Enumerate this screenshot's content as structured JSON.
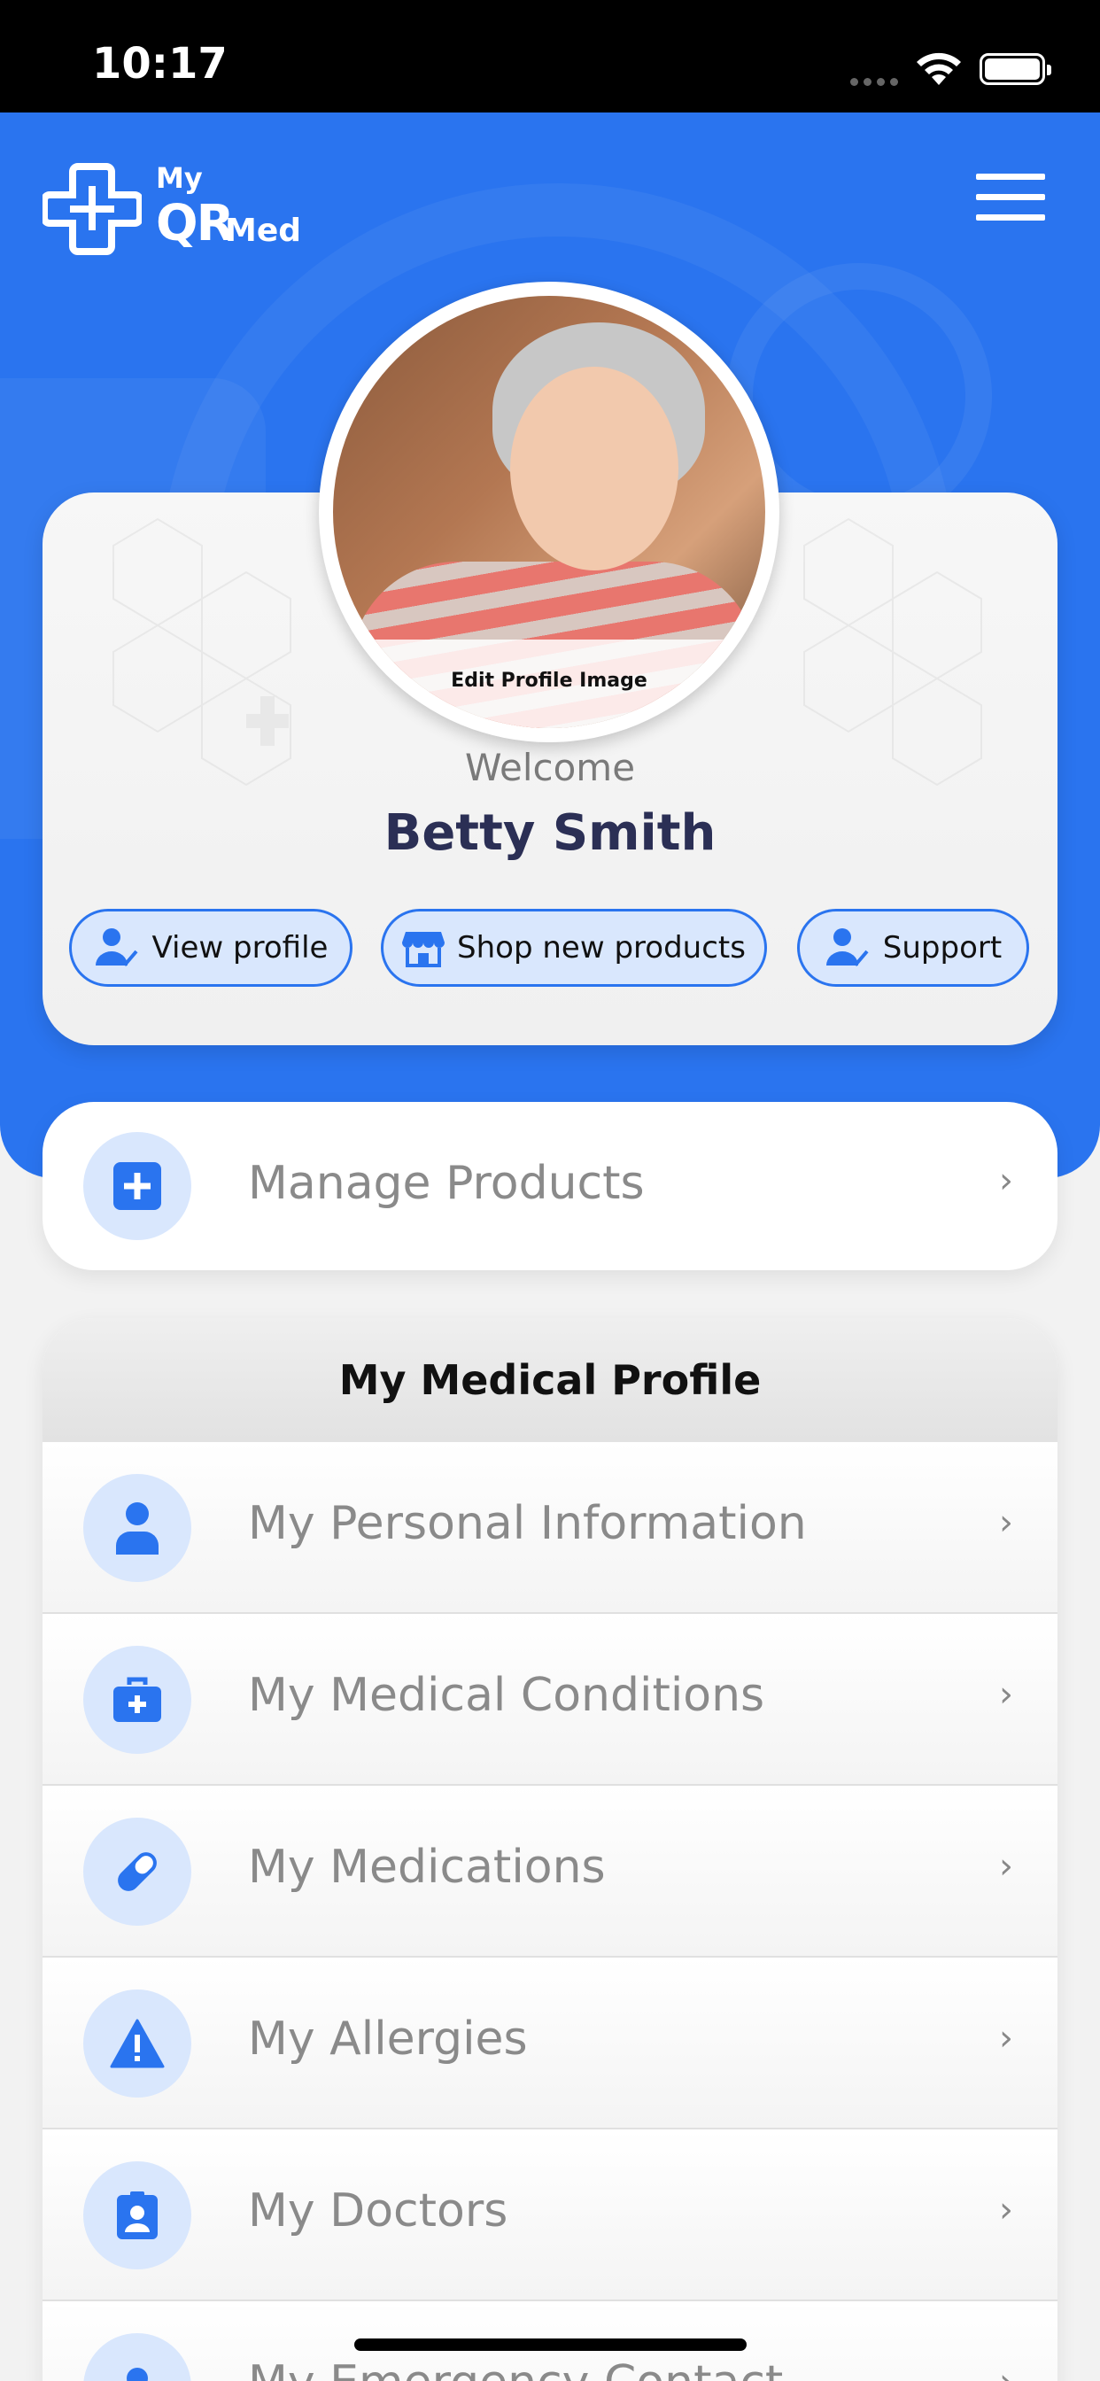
{
  "status_bar": {
    "time": "10:17"
  },
  "app": {
    "logo_my": "My",
    "logo_qr": "QR",
    "logo_med": "Med"
  },
  "profile": {
    "edit_image_label": "Edit Profile Image",
    "welcome": "Welcome",
    "name": "Betty Smith",
    "actions": [
      {
        "label": "View profile",
        "icon": "user-check-icon"
      },
      {
        "label": "Shop new products",
        "icon": "store-icon"
      },
      {
        "label": "Support",
        "icon": "user-check-icon"
      }
    ]
  },
  "manage_products": {
    "label": "Manage Products",
    "icon": "plus-square-icon"
  },
  "medical_profile": {
    "title": "My Medical Profile",
    "items": [
      {
        "label": "My Personal Information",
        "icon": "person-icon"
      },
      {
        "label": "My Medical Conditions",
        "icon": "medkit-icon"
      },
      {
        "label": "My Medications",
        "icon": "pill-icon"
      },
      {
        "label": "My Allergies",
        "icon": "warning-icon"
      },
      {
        "label": "My Doctors",
        "icon": "id-badge-icon"
      },
      {
        "label": "My Emergency Contact",
        "icon": "contact-icon"
      }
    ]
  },
  "colors": {
    "brand": "#2a74ef",
    "pill_bg": "#d9e7fd",
    "name_text": "#2b2f55"
  }
}
